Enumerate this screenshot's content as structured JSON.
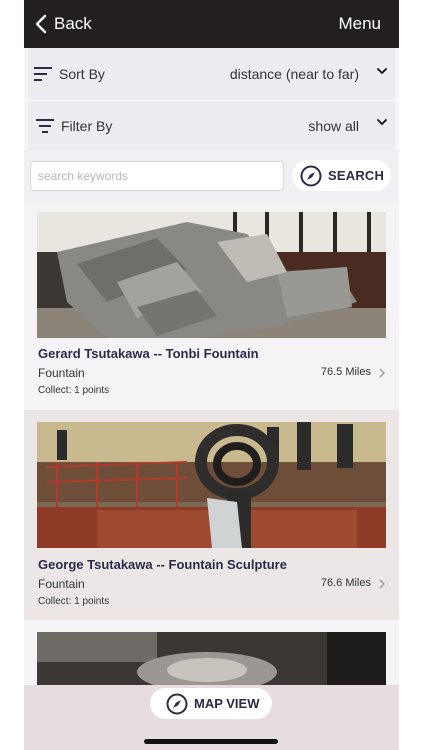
{
  "nav": {
    "back_label": "Back",
    "menu_label": "Menu"
  },
  "sort": {
    "label": "Sort By",
    "value": "distance (near to far)"
  },
  "filter": {
    "label": "Filter By",
    "value": "show all"
  },
  "search": {
    "placeholder": "search keywords",
    "value": "",
    "button_label": "SEARCH"
  },
  "items": [
    {
      "title": "Gerard Tsutakawa -- Tonbi Fountain",
      "type": "Fountain",
      "distance": "76.5 Miles",
      "points": "Collect: 1 points"
    },
    {
      "title": "George Tsutakawa -- Fountain Sculpture",
      "type": "Fountain",
      "distance": "76.6 Miles",
      "points": "Collect: 1 points"
    }
  ],
  "map_button_label": "MAP VIEW",
  "colors": {
    "nav_bg": "#231f20",
    "accent": "#2e2a49",
    "page_bg": "#f1eff3"
  },
  "icons": {
    "back": "chevron-left-icon",
    "sort": "sort-lines-icon",
    "filter": "filter-funnel-lines-icon",
    "search": "compass-icon",
    "map": "compass-icon",
    "row_arrow": "chevron-right-icon"
  }
}
